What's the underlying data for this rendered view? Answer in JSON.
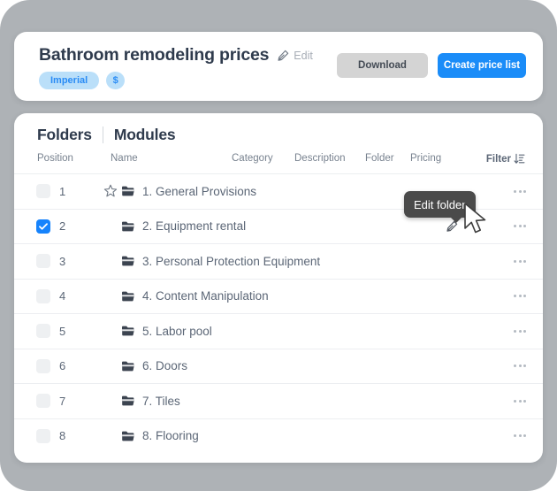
{
  "header": {
    "title": "Bathroom remodeling prices",
    "edit_label": "Edit",
    "edit_icon": "pencil-icon",
    "badges": [
      {
        "label": "Imperial",
        "name": "units-badge"
      },
      {
        "label": "$",
        "name": "currency-badge"
      }
    ],
    "buttons": {
      "download_label": "Download",
      "create_label": "Create price list"
    }
  },
  "tabs": [
    {
      "label": "Folders",
      "active": true
    },
    {
      "label": "Modules",
      "active": false
    }
  ],
  "columns": {
    "position": "Position",
    "name": "Name",
    "category": "Category",
    "description": "Description",
    "folder": "Folder",
    "pricing": "Pricing",
    "filter": "Filter",
    "filter_icon": "sort-descending-icon"
  },
  "rows": [
    {
      "position": "1",
      "name": "1. General Provisions",
      "checked": false,
      "starred": true
    },
    {
      "position": "2",
      "name": "2. Equipment rental",
      "checked": true,
      "starred": false
    },
    {
      "position": "3",
      "name": "3. Personal Protection Equipment",
      "checked": false,
      "starred": false
    },
    {
      "position": "4",
      "name": "4. Content Manipulation",
      "checked": false,
      "starred": false
    },
    {
      "position": "5",
      "name": "5. Labor pool",
      "checked": false,
      "starred": false
    },
    {
      "position": "6",
      "name": "6. Doors",
      "checked": false,
      "starred": false
    },
    {
      "position": "7",
      "name": "7. Tiles",
      "checked": false,
      "starred": false
    },
    {
      "position": "8",
      "name": "8. Flooring",
      "checked": false,
      "starred": false
    }
  ],
  "tooltip": {
    "text": "Edit folder",
    "target_icon": "pencil-icon"
  },
  "colors": {
    "accent_blue": "#1a8cf8",
    "badge_bg": "#badff9",
    "badge_text": "#2a8cf5",
    "text_dark": "#2f3b4d",
    "text_muted": "#78828f",
    "tooltip_bg": "#4a4a4a",
    "page_bg": "#aeb2b6"
  }
}
